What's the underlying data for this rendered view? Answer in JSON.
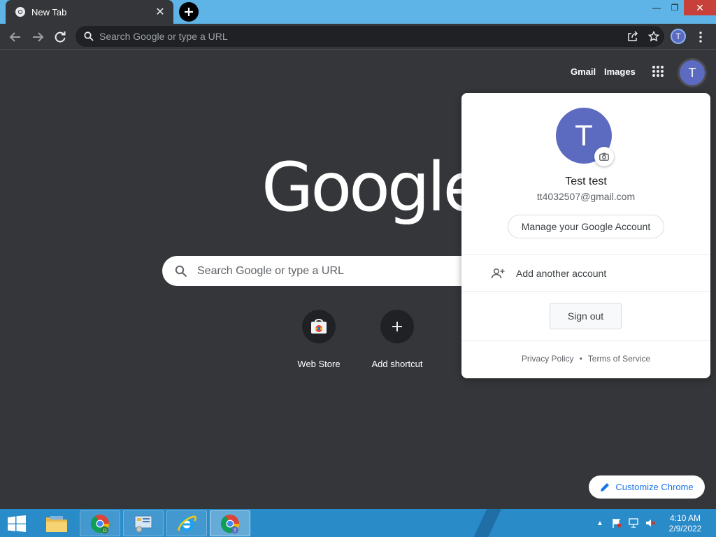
{
  "browser": {
    "tab_title": "New Tab",
    "omnibox_placeholder": "Search Google or type a URL",
    "profile_initial": "T"
  },
  "page": {
    "links": {
      "gmail": "Gmail",
      "images": "Images"
    },
    "avatar_initial": "T",
    "logo_text": "Google",
    "search_placeholder": "Search Google or type a URL",
    "shortcuts": [
      {
        "label": "Web Store",
        "icon": "web-store-icon"
      },
      {
        "label": "Add shortcut",
        "icon": "plus-icon"
      }
    ],
    "customize_label": "Customize Chrome"
  },
  "account_popup": {
    "avatar_initial": "T",
    "name": "Test test",
    "email": "tt4032507@gmail.com",
    "manage_label": "Manage your Google Account",
    "add_account_label": "Add another account",
    "sign_out_label": "Sign out",
    "privacy_label": "Privacy Policy",
    "separator": "•",
    "terms_label": "Terms of Service"
  },
  "taskbar": {
    "items": [
      {
        "name": "file-explorer",
        "icon": "folder-icon"
      },
      {
        "name": "chrome-d",
        "icon": "chrome-icon"
      },
      {
        "name": "control-panel",
        "icon": "control-panel-icon"
      },
      {
        "name": "internet-explorer",
        "icon": "ie-icon"
      },
      {
        "name": "chrome-t",
        "icon": "chrome-icon"
      }
    ],
    "time": "4:10 AM",
    "date": "2/9/2022"
  },
  "colors": {
    "page_bg": "#35363a",
    "titlebar": "#5eb4e6",
    "avatar": "#5c6bc0",
    "link_blue": "#1a73e8",
    "taskbar": "#2a8bc9"
  }
}
